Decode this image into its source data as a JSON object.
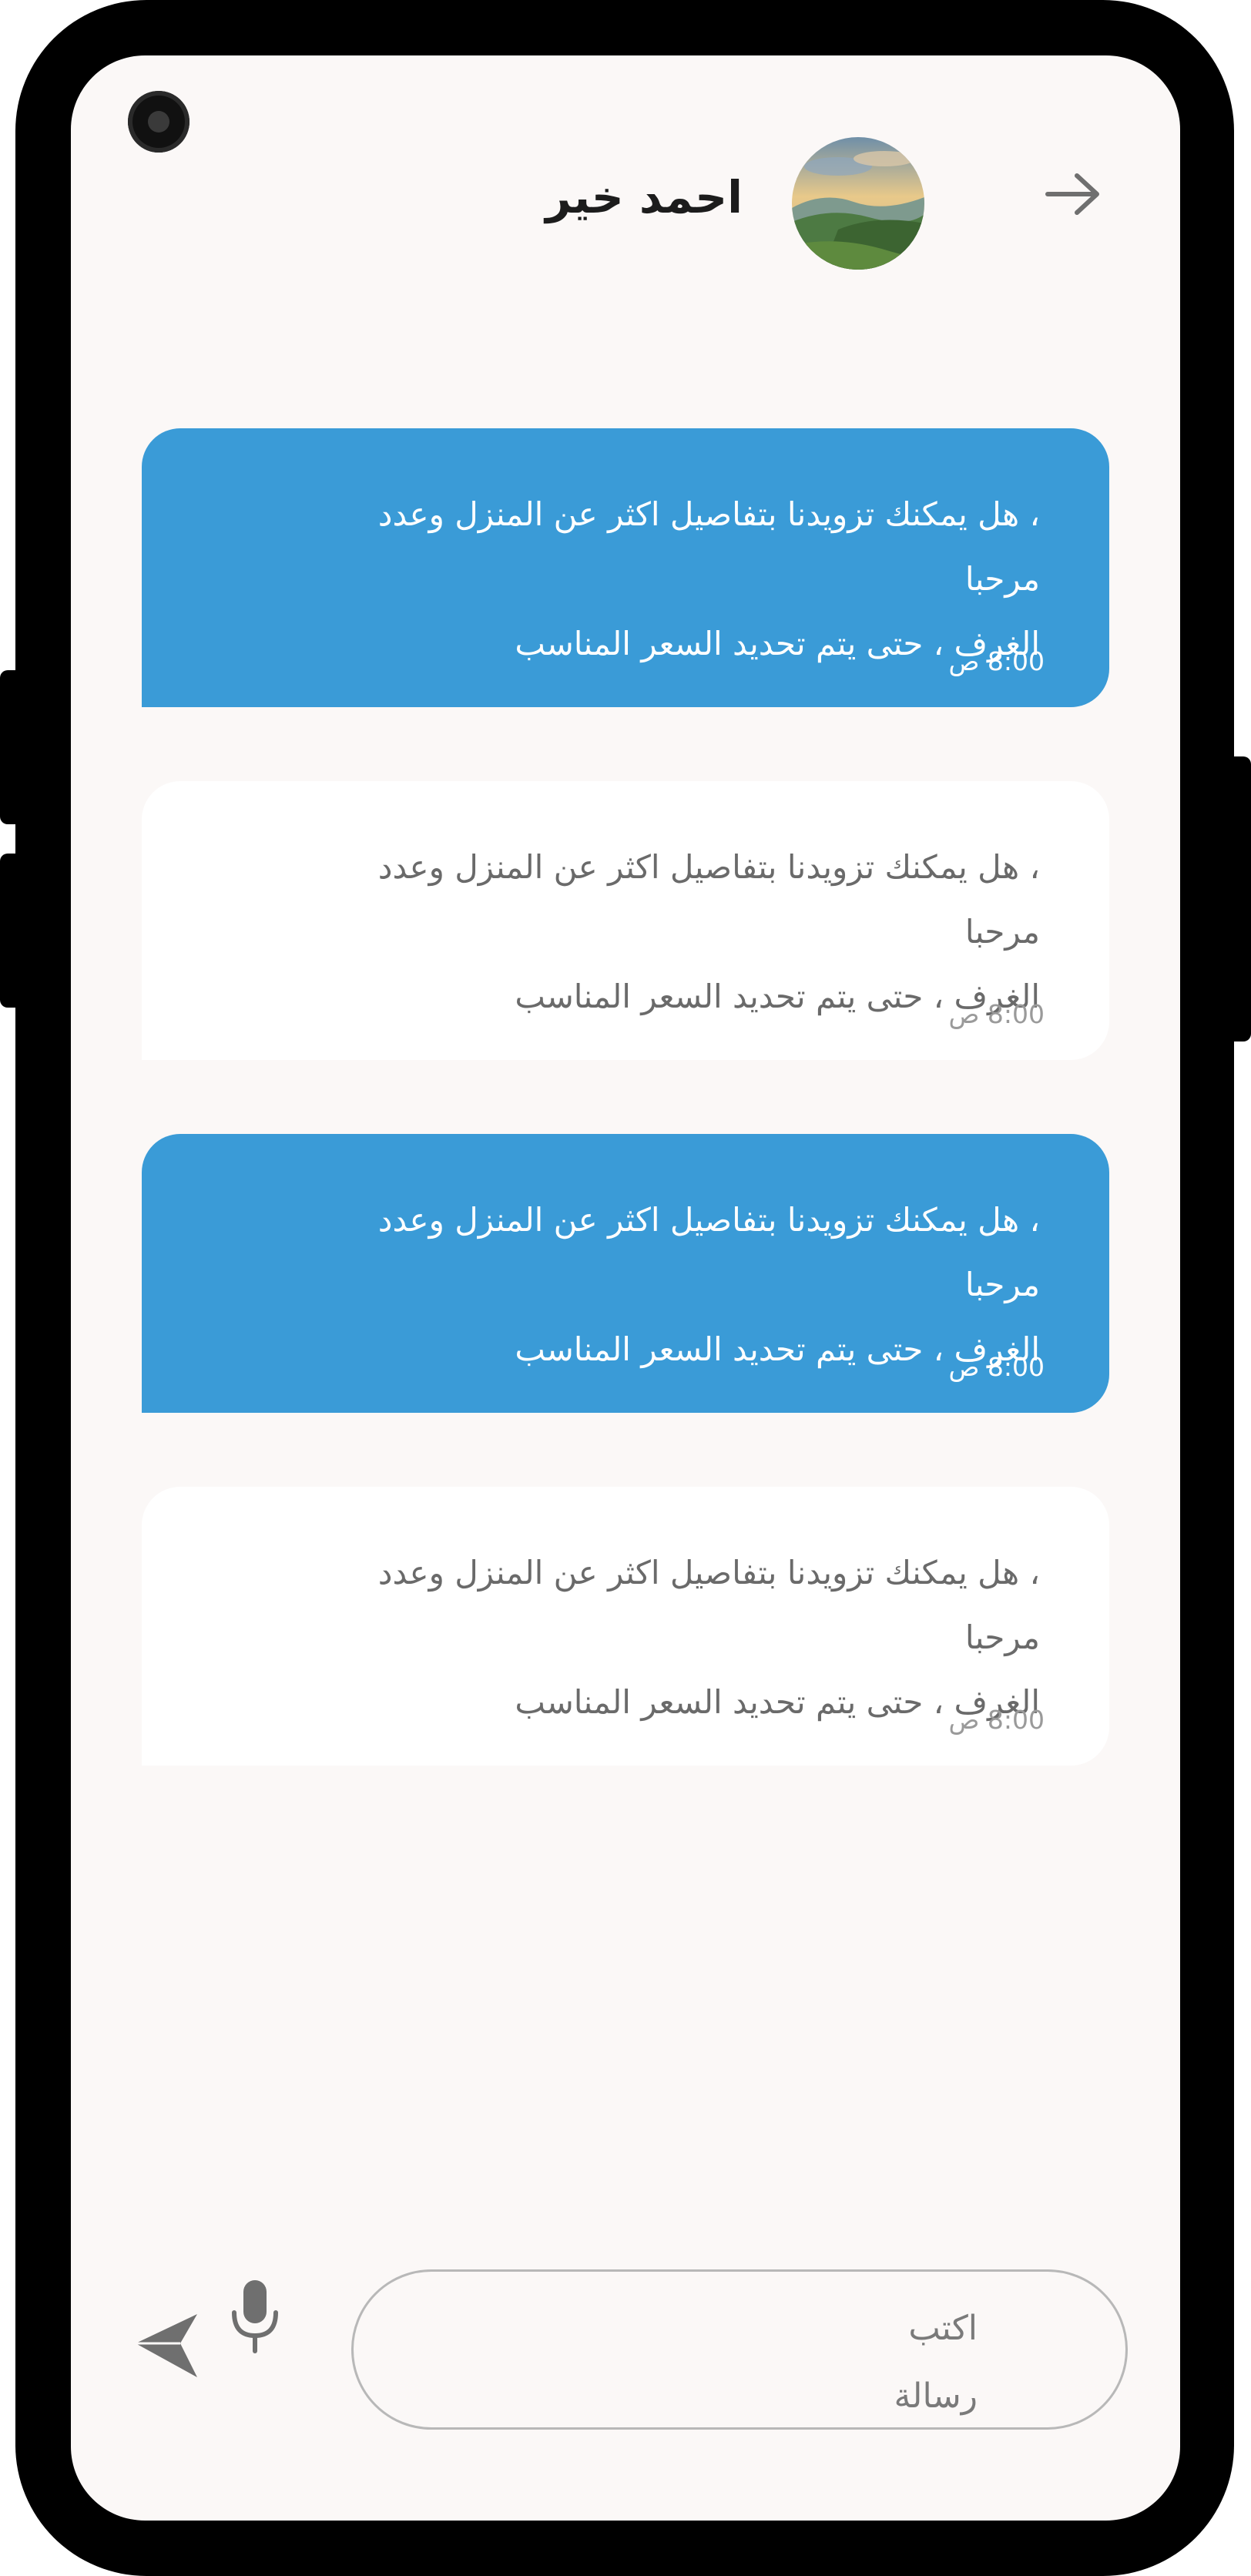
{
  "header": {
    "contact_name": "احمد خير",
    "back_icon": "arrow-right-icon",
    "avatar": "landscape-photo"
  },
  "messages": [
    {
      "type": "sent",
      "lines": [
        "، هل يمكنك تزويدنا بتفاصيل اكثر عن المنزل وعدد",
        "مرحبا",
        "الغرف ، حتى يتم تحديد السعر المناسب"
      ],
      "time": "8:00 ص"
    },
    {
      "type": "received",
      "lines": [
        "، هل يمكنك تزويدنا بتفاصيل اكثر عن المنزل وعدد",
        "مرحبا",
        "الغرف ، حتى يتم تحديد السعر المناسب"
      ],
      "time": "8:00 ص"
    },
    {
      "type": "sent",
      "lines": [
        "، هل يمكنك تزويدنا بتفاصيل اكثر عن المنزل وعدد",
        "مرحبا",
        "الغرف ، حتى يتم تحديد السعر المناسب"
      ],
      "time": "8:00 ص"
    },
    {
      "type": "received",
      "lines": [
        "، هل يمكنك تزويدنا بتفاصيل اكثر عن المنزل وعدد",
        "مرحبا",
        "الغرف ، حتى يتم تحديد السعر المناسب"
      ],
      "time": "8:00 ص"
    }
  ],
  "composer": {
    "placeholder_line1": "اكتب",
    "placeholder_line2": "رسالة",
    "mic_icon": "microphone-icon",
    "send_icon": "send-icon"
  },
  "colors": {
    "sent_bubble": "#3a9bd7",
    "received_bubble": "#ffffff",
    "screen_background": "#fbf8f7"
  }
}
